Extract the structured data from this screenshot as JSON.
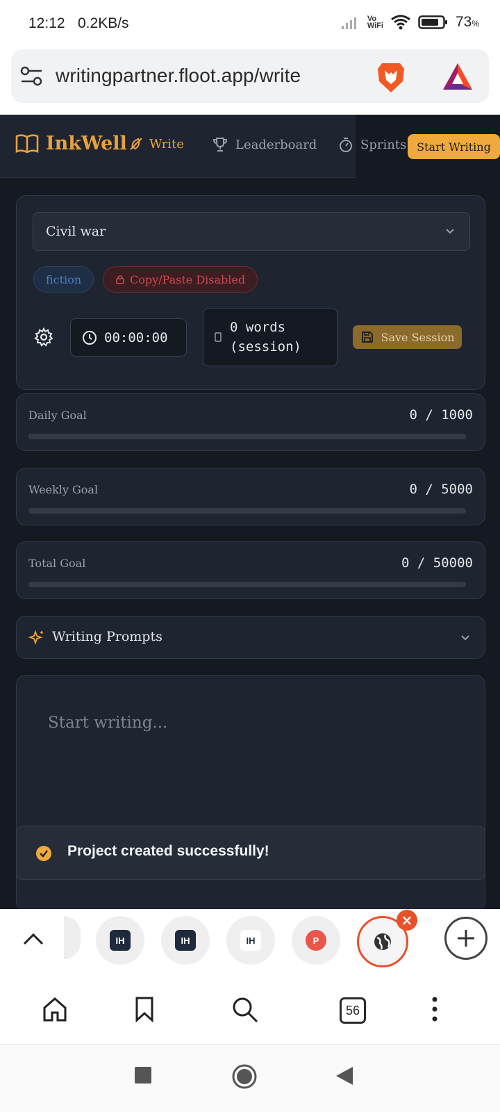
{
  "status_bar": {
    "time": "12:12",
    "net_speed": "0.2KB/s",
    "vowifi_top": "Vo",
    "vowifi_bottom": "WiFi",
    "battery": "73",
    "battery_unit": "%"
  },
  "browser": {
    "url": "writingpartner.floot.app/write",
    "tab_count": "56"
  },
  "nav": {
    "brand": "InkWell",
    "write": "Write",
    "leaderboard": "Leaderboard",
    "sprints": "Sprints",
    "start_writing": "Start Writing"
  },
  "project": {
    "selected": "Civil war",
    "tag_genre": "fiction",
    "tag_copy": "Copy/Paste Disabled",
    "timer": "00:00:00",
    "words_line1": "0 words",
    "words_line2": "(session)",
    "save_label": "Save Session"
  },
  "goals": [
    {
      "label": "Daily Goal",
      "value": "0 / 1000",
      "progress": 0
    },
    {
      "label": "Weekly Goal",
      "value": "0 / 5000",
      "progress": 0
    },
    {
      "label": "Total Goal",
      "value": "0 / 50000",
      "progress": 0
    }
  ],
  "prompts": {
    "title": "Writing Prompts"
  },
  "editor": {
    "placeholder": "Start writing..."
  },
  "toast": {
    "message": "Project created successfully!"
  },
  "tabs": [
    {
      "icon": "IH",
      "bg": "#1d2b3c",
      "fg": "#ffffff"
    },
    {
      "icon": "IH",
      "bg": "#1d2b3c",
      "fg": "#ffffff"
    },
    {
      "icon": "IH",
      "bg": "#ffffff",
      "fg": "#1d2b3c"
    },
    {
      "icon": "P",
      "bg": "#e8554a",
      "fg": "#ffffff"
    }
  ],
  "colors": {
    "accent": "#e9a23b",
    "page_bg": "#141922",
    "card_bg": "#1f2530",
    "brave_orange": "#e8512a"
  }
}
